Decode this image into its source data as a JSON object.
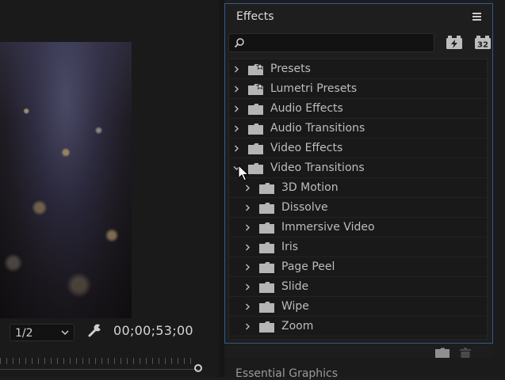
{
  "monitor": {
    "resolution": "1/2",
    "timecode": "00;00;53;00"
  },
  "effects_panel": {
    "title": "Effects",
    "search": {
      "value": "",
      "placeholder": ""
    },
    "toolbar": {
      "accelerated_icon": "accelerated-effects-icon",
      "bit_depth_label": "32"
    },
    "items": [
      {
        "label": "Presets",
        "level": 0,
        "expanded": false,
        "icon": "preset-folder-icon"
      },
      {
        "label": "Lumetri Presets",
        "level": 0,
        "expanded": false,
        "icon": "preset-folder-icon"
      },
      {
        "label": "Audio Effects",
        "level": 0,
        "expanded": false,
        "icon": "folder-icon"
      },
      {
        "label": "Audio Transitions",
        "level": 0,
        "expanded": false,
        "icon": "folder-icon"
      },
      {
        "label": "Video Effects",
        "level": 0,
        "expanded": false,
        "icon": "folder-icon"
      },
      {
        "label": "Video Transitions",
        "level": 0,
        "expanded": true,
        "icon": "folder-icon"
      },
      {
        "label": "3D Motion",
        "level": 1,
        "expanded": false,
        "icon": "folder-icon"
      },
      {
        "label": "Dissolve",
        "level": 1,
        "expanded": false,
        "icon": "folder-icon"
      },
      {
        "label": "Immersive Video",
        "level": 1,
        "expanded": false,
        "icon": "folder-icon"
      },
      {
        "label": "Iris",
        "level": 1,
        "expanded": false,
        "icon": "folder-icon"
      },
      {
        "label": "Page Peel",
        "level": 1,
        "expanded": false,
        "icon": "folder-icon"
      },
      {
        "label": "Slide",
        "level": 1,
        "expanded": false,
        "icon": "folder-icon"
      },
      {
        "label": "Wipe",
        "level": 1,
        "expanded": false,
        "icon": "folder-icon"
      },
      {
        "label": "Zoom",
        "level": 1,
        "expanded": false,
        "icon": "folder-icon"
      }
    ]
  },
  "next_panel": {
    "title": "Essential Graphics"
  },
  "colors": {
    "panel_border": "#2f5c8f",
    "background": "#1d1d1d",
    "text": "#bdbdbd"
  }
}
